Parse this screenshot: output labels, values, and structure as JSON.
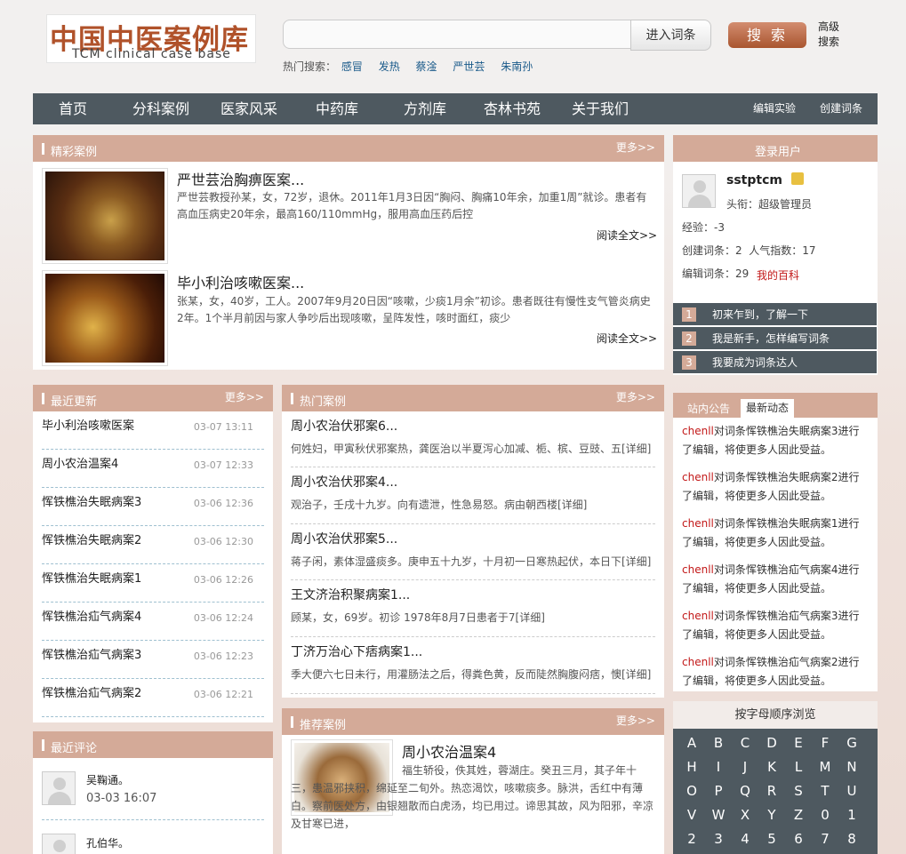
{
  "header": {
    "logo_cn": "中国中医案例库",
    "logo_en": "TCM clinical case base",
    "search_placeholder": "",
    "enter_label": "进入词条",
    "search_label": "搜 索",
    "advanced_label": "高级搜索",
    "hot_label": "热门搜索：",
    "hot_keywords": [
      "感冒",
      "发热",
      "蔡淦",
      "严世芸",
      "朱南孙"
    ]
  },
  "nav": {
    "items": [
      "首页",
      "分科案例",
      "医家风采",
      "中药库",
      "方剂库",
      "杏林书苑",
      "关于我们"
    ],
    "right": [
      "编辑实验",
      "创建词条"
    ]
  },
  "featured": {
    "title": "精彩案例",
    "more": "更多>>",
    "items": [
      {
        "title": "严世芸治胸痹医案...",
        "desc": "严世芸教授孙某，女，72岁，退休。2011年1月3日因“胸闷、胸痛10年余，加重1周”就诊。患者有高血压病史20年余，最高160/110mmHg，服用高血压药后控",
        "more": "阅读全文>>"
      },
      {
        "title": "毕小利治咳嗽医案...",
        "desc": "张某，女，40岁，工人。2007年9月20日因“咳嗽，少痰1月余”初诊。患者既往有慢性支气管炎病史2年。1个半月前因与家人争吵后出现咳嗽，呈阵发性，咳时面红，痰少",
        "more": "阅读全文>>"
      }
    ]
  },
  "user": {
    "title": "登录用户",
    "name": "sstptcm",
    "rank": "头衔：超级管理员",
    "exp": "经验：-3",
    "created": "创建词条：2  人气指数：17",
    "edited": "编辑词条：29",
    "my_wiki": "我的百科",
    "help": [
      "初来乍到，了解一下",
      "我是新手，怎样编写词条",
      "我要成为词条达人"
    ],
    "help_nums": [
      "1",
      "2",
      "3"
    ]
  },
  "recent": {
    "title": "最近更新",
    "more": "更多>>",
    "items": [
      {
        "t": "毕小利治咳嗽医案",
        "d": "03-07 13:11"
      },
      {
        "t": "周小农治温案4",
        "d": "03-07 12:33"
      },
      {
        "t": "恽铁樵治失眠病案3",
        "d": "03-06 12:36"
      },
      {
        "t": "恽铁樵治失眠病案2",
        "d": "03-06 12:30"
      },
      {
        "t": "恽铁樵治失眠病案1",
        "d": "03-06 12:26"
      },
      {
        "t": "恽铁樵治疝气病案4",
        "d": "03-06 12:24"
      },
      {
        "t": "恽铁樵治疝气病案3",
        "d": "03-06 12:23"
      },
      {
        "t": "恽铁樵治疝气病案2",
        "d": "03-06 12:21"
      }
    ]
  },
  "hot_cases": {
    "title": "热门案例",
    "more": "更多>>",
    "items": [
      {
        "t": "周小农治伏邪案6...",
        "d": "何姓妇，甲寅秋伏邪案热，龚医治以半夏泻心加减、栀、槟、豆豉、五[详细]"
      },
      {
        "t": "周小农治伏邪案4...",
        "d": "观治子，壬戌十九岁。向有遗泄，性急易怒。病由朝西楼[详细]"
      },
      {
        "t": "周小农治伏邪案5...",
        "d": "蒋子闲，素体湿盛痰多。庚申五十九岁，十月初一日寒热起伏，本日下[详细]"
      },
      {
        "t": "王文济治积聚病案1...",
        "d": "顾某，女，69岁。初诊  1978年8月7日患者于7[详细]"
      },
      {
        "t": "丁济万治心下痞病案1...",
        "d": "季大便六七日未行，用灌肠法之后，得粪色黄，反而陡然胸腹闷痞，懊[详细]"
      }
    ]
  },
  "notices": {
    "tab1": "站内公告",
    "tab2": "最新动态",
    "items": [
      {
        "u": "chenll",
        "t": "对词条恽铁樵治失眠病案3进行了编辑，将使更多人因此受益。"
      },
      {
        "u": "chenll",
        "t": "对词条恽铁樵治失眠病案2进行了编辑，将使更多人因此受益。"
      },
      {
        "u": "chenll",
        "t": "对词条恽铁樵治失眠病案1进行了编辑，将使更多人因此受益。"
      },
      {
        "u": "chenll",
        "t": "对词条恽铁樵治疝气病案4进行了编辑，将使更多人因此受益。"
      },
      {
        "u": "chenll",
        "t": "对词条恽铁樵治疝气病案3进行了编辑，将使更多人因此受益。"
      },
      {
        "u": "chenll",
        "t": "对词条恽铁樵治疝气病案2进行了编辑，将使更多人因此受益。"
      }
    ]
  },
  "comments": {
    "title": "最近评论",
    "items": [
      {
        "name": "吴鞠通。",
        "time": "03-03 16:07"
      },
      {
        "name": "孔伯华。",
        "time": ""
      }
    ]
  },
  "recommended": {
    "title": "推荐案例",
    "more": "更多>>",
    "item_title": "周小农治温案4",
    "item_desc": "福生轿役，佚其姓，蓉湖庄。癸丑三月，其子年十三，患温邪挟积，绵延至二旬外。热恋渴饮，咳嗽痰多。脉洪，舌红中有薄白。察前医处方，由银翘散而白虎汤，均已用过。谛思其故，风为阳邪，辛凉及甘寒已进，"
  },
  "browse": {
    "title": "按字母顺序浏览",
    "letters": [
      "A",
      "B",
      "C",
      "D",
      "E",
      "F",
      "G",
      "H",
      "I",
      "J",
      "K",
      "L",
      "M",
      "N",
      "O",
      "P",
      "Q",
      "R",
      "S",
      "T",
      "U",
      "V",
      "W",
      "X",
      "Y",
      "Z",
      "0",
      "1",
      "2",
      "3",
      "4",
      "5",
      "6",
      "7",
      "8"
    ]
  }
}
